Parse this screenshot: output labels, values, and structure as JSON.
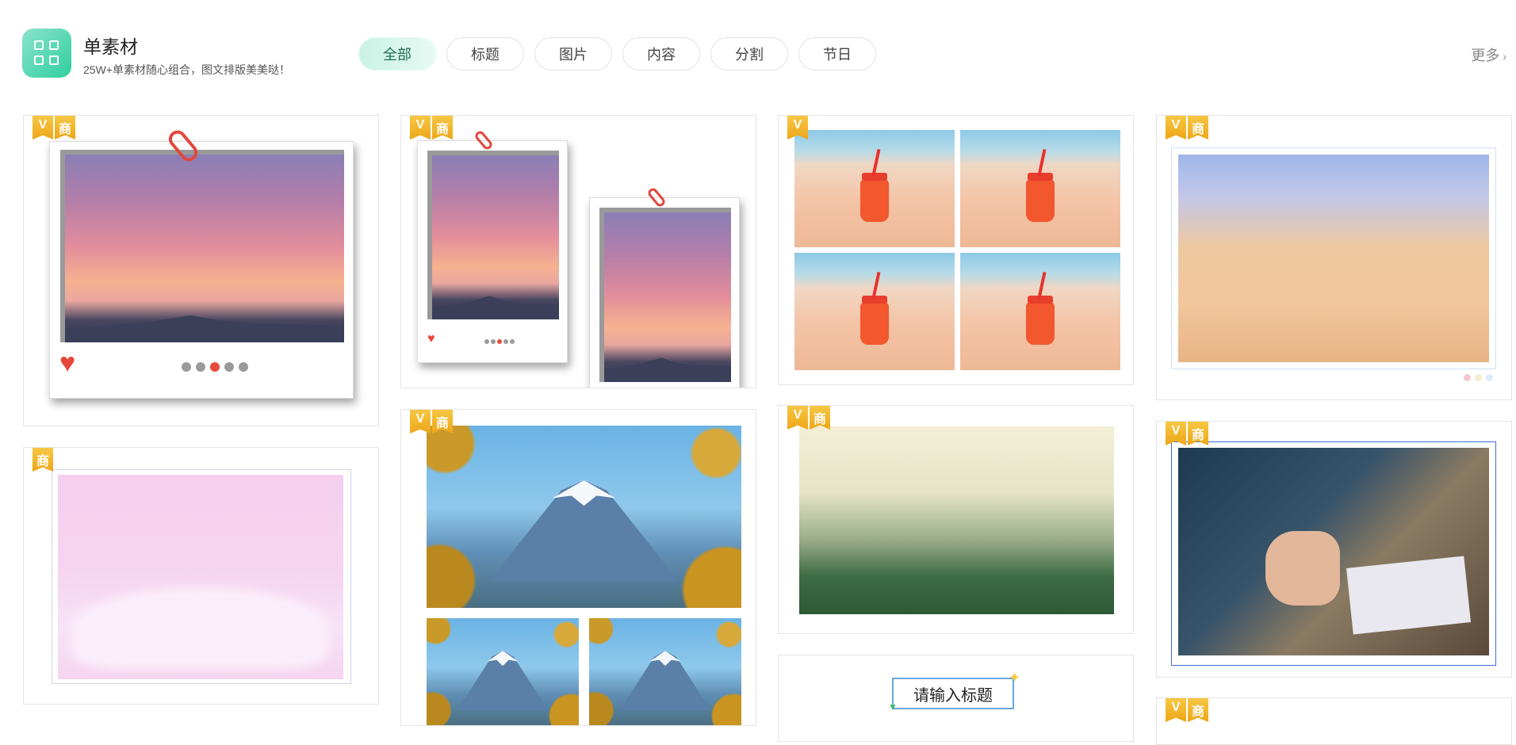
{
  "header": {
    "title": "单素材",
    "subtitle": "25W+单素材随心组合，图文排版美美哒！",
    "more_label": "更多",
    "more_icon": "chevron-right-icon"
  },
  "tabs": [
    {
      "label": "全部",
      "active": true
    },
    {
      "label": "标题",
      "active": false
    },
    {
      "label": "图片",
      "active": false
    },
    {
      "label": "内容",
      "active": false
    },
    {
      "label": "分割",
      "active": false
    },
    {
      "label": "节日",
      "active": false
    }
  ],
  "badges": {
    "vip_label": "V",
    "commercial_label": "商"
  },
  "cards": {
    "title_input_placeholder": "请输入标题"
  },
  "colors": {
    "accent": "#2fcf9e",
    "active_tab_bg": "#c9f2e4",
    "badge": "#f2b526"
  }
}
